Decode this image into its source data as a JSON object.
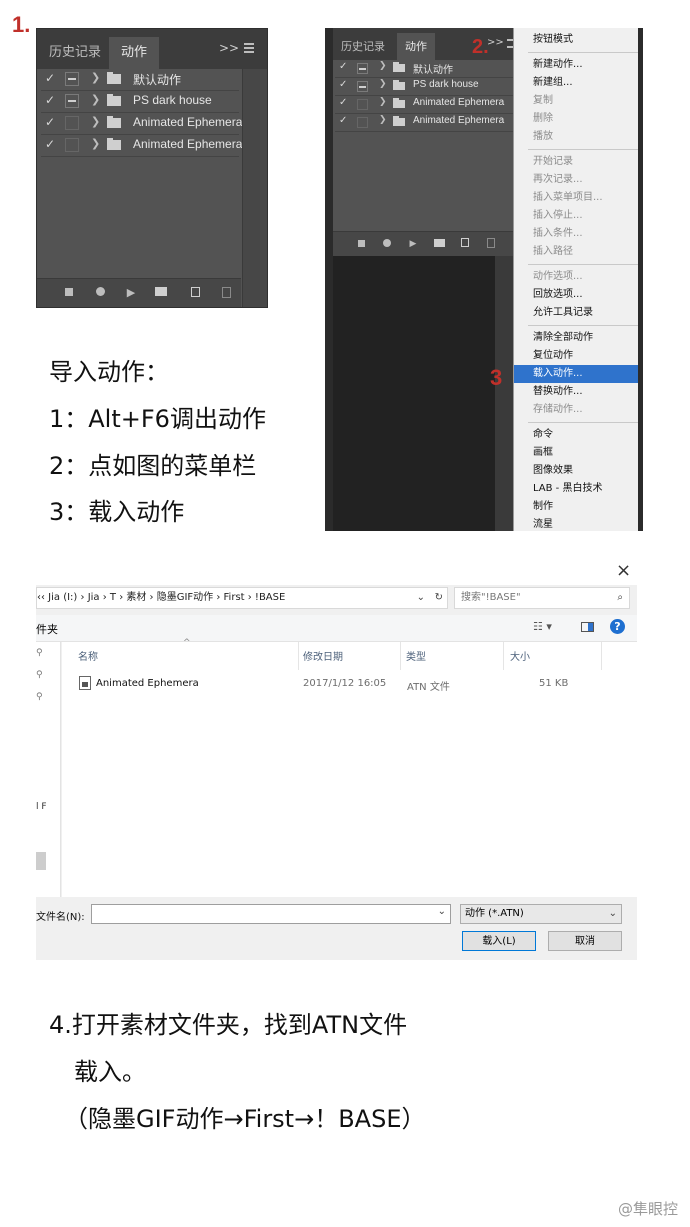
{
  "colors": {
    "step_marker": "#c0302a",
    "panel_bg": "#535353",
    "menu_highlight": "#2f73cc"
  },
  "steps": {
    "s1": "1.",
    "s2": "2.",
    "s3": "3"
  },
  "panel1": {
    "tabs": [
      "历史记录",
      "动作"
    ],
    "menu_glyph": ">>",
    "items": [
      {
        "check": "✓",
        "dialog_toggle": true,
        "label": "默认动作"
      },
      {
        "check": "✓",
        "dialog_toggle": true,
        "label": "PS dark house"
      },
      {
        "check": "✓",
        "dialog_toggle": false,
        "label": "Animated Ephemera"
      },
      {
        "check": "✓",
        "dialog_toggle": false,
        "label": "Animated Ephemera"
      }
    ],
    "bottom_icons": [
      "stop-icon",
      "record-icon",
      "play-icon",
      "folder-icon",
      "new-action-icon",
      "trash-icon"
    ]
  },
  "panel2": {
    "tabs": [
      "历史记录",
      "动作"
    ],
    "menu_glyph": ">>",
    "items": [
      {
        "check": "✓",
        "dialog_toggle": true,
        "label": "默认动作"
      },
      {
        "check": "✓",
        "dialog_toggle": true,
        "label": "PS dark house"
      },
      {
        "check": "✓",
        "dialog_toggle": false,
        "label": "Animated Ephemera"
      },
      {
        "check": "✓",
        "dialog_toggle": false,
        "label": "Animated Ephemera"
      }
    ]
  },
  "menu": {
    "groups": [
      [
        {
          "label": "按钮模式",
          "disabled": false
        }
      ],
      [
        {
          "label": "新建动作...",
          "disabled": false
        },
        {
          "label": "新建组...",
          "disabled": false
        },
        {
          "label": "复制",
          "disabled": true
        },
        {
          "label": "删除",
          "disabled": true
        },
        {
          "label": "播放",
          "disabled": true
        }
      ],
      [
        {
          "label": "开始记录",
          "disabled": true
        },
        {
          "label": "再次记录...",
          "disabled": true
        },
        {
          "label": "插入菜单项目...",
          "disabled": true
        },
        {
          "label": "插入停止...",
          "disabled": true
        },
        {
          "label": "插入条件...",
          "disabled": true
        },
        {
          "label": "插入路径",
          "disabled": true
        }
      ],
      [
        {
          "label": "动作选项...",
          "disabled": true
        },
        {
          "label": "回放选项...",
          "disabled": false
        },
        {
          "label": "允许工具记录",
          "disabled": false
        }
      ],
      [
        {
          "label": "清除全部动作",
          "disabled": false
        },
        {
          "label": "复位动作",
          "disabled": false
        },
        {
          "label": "载入动作...",
          "disabled": false,
          "selected": true
        },
        {
          "label": "替换动作...",
          "disabled": false
        },
        {
          "label": "存储动作...",
          "disabled": true
        }
      ],
      [
        {
          "label": "命令",
          "disabled": false
        },
        {
          "label": "画框",
          "disabled": false
        },
        {
          "label": "图像效果",
          "disabled": false
        },
        {
          "label": "LAB - 黑白技术",
          "disabled": false
        },
        {
          "label": "制作",
          "disabled": false
        },
        {
          "label": "流星",
          "disabled": false
        }
      ]
    ]
  },
  "instructions1": {
    "title": "导入动作：",
    "line1": "1：Alt+F6调出动作",
    "line2": "2：点如图的菜单栏",
    "line3": "3：载入动作"
  },
  "dialog": {
    "close": "×",
    "address": "‹‹  Jia (I:)  ›  Jia  ›  T  ›  素材  ›  隐墨GIF动作  ›  First  ›  !BASE",
    "search_placeholder": "搜索\"!BASE\"",
    "left_cmd": "件夹",
    "view_icons": [
      "view-options-icon",
      "preview-pane-icon",
      "help-icon"
    ],
    "columns": [
      "名称",
      "修改日期",
      "类型",
      "大小"
    ],
    "files": [
      {
        "name": "Animated Ephemera",
        "date": "2017/1/12 16:05",
        "type": "ATN 文件",
        "size": "51 KB"
      }
    ],
    "nav_partial": "l F",
    "filename_label": "文件名(N):",
    "filename_value": "",
    "filetype": "动作 (*.ATN)",
    "ok": "载入(L)",
    "cancel": "取消"
  },
  "instructions2": {
    "line1": "4.打开素材文件夹，找到ATN文件",
    "line2": "载入。",
    "line3": "（隐墨GIF动作→First→！BASE）"
  },
  "watermark": "@隼眼控"
}
